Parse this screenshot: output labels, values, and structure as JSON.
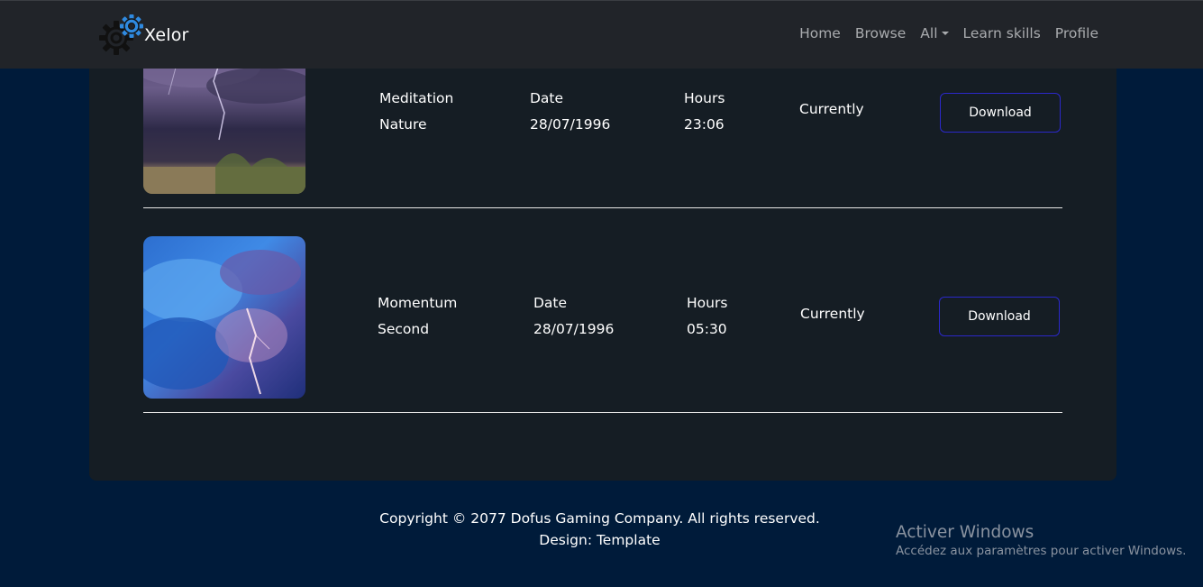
{
  "navbar": {
    "brand": "Xelor",
    "links": [
      {
        "label": "Home"
      },
      {
        "label": "Browse"
      },
      {
        "label": "All"
      },
      {
        "label": "Learn skills"
      },
      {
        "label": "Profile"
      }
    ]
  },
  "downloads": [
    {
      "name_line1": "Meditation",
      "name_line2": "Nature",
      "date_label": "Date",
      "date_value": "28/07/1996",
      "hours_label": "Hours",
      "hours_value": "23:06",
      "status": "Currently",
      "button_label": "Download"
    },
    {
      "name_line1": "Momentum",
      "name_line2": "Second",
      "date_label": "Date",
      "date_value": "28/07/1996",
      "hours_label": "Hours",
      "hours_value": "05:30",
      "status": "Currently",
      "button_label": "Download"
    }
  ],
  "footer": {
    "copyright": "Copyright © 2077 Dofus Gaming Company. All rights reserved.",
    "design": "Design: Template"
  },
  "watermark": {
    "title": "Activer Windows",
    "subtitle": "Accédez aux paramètres pour activer Windows."
  },
  "colors": {
    "background": "#001b3a",
    "navbar": "#212429",
    "panel": "#151d24",
    "button_border": "#2b28c9",
    "logo_blue": "#2f8ae0"
  }
}
